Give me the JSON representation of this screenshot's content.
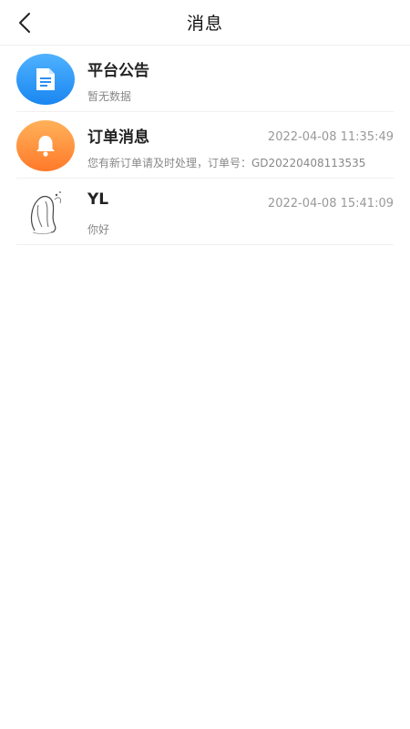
{
  "header": {
    "title": "消息"
  },
  "items": [
    {
      "title": "平台公告",
      "time": "",
      "subtitle": "暂无数据",
      "icon": "document-icon"
    },
    {
      "title": "订单消息",
      "time": "2022-04-08 11:35:49",
      "subtitle": "您有新订单请及时处理，订单号：GD20220408113535",
      "icon": "bell-icon"
    },
    {
      "title": "YL",
      "time": "2022-04-08 15:41:09",
      "subtitle": "你好",
      "icon": "user-avatar"
    }
  ]
}
